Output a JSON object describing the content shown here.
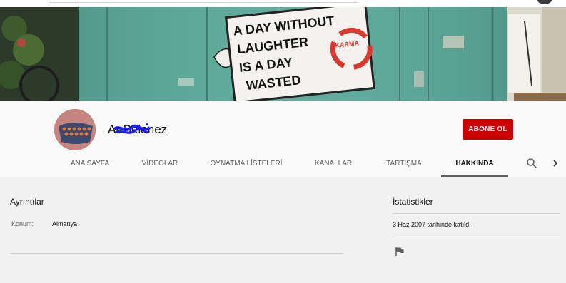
{
  "channel": {
    "name": "Ar Belanez",
    "subscribe_label": "ABONE OL"
  },
  "tabs": [
    {
      "label": "ANA SAYFA"
    },
    {
      "label": "VİDEOLAR"
    },
    {
      "label": "OYNATMA LİSTELERİ"
    },
    {
      "label": "KANALLAR"
    },
    {
      "label": "TARTIŞMA"
    },
    {
      "label": "HAKKINDA"
    }
  ],
  "active_tab": "HAKKINDA",
  "icons": {
    "tab_search": "search-icon",
    "tab_next": "chevron-right-icon",
    "report": "flag-icon"
  },
  "details": {
    "title": "Ayrıntılar",
    "location_label": "Konum:",
    "location_value": "Almanya"
  },
  "stats": {
    "title": "İstatistikler",
    "joined": "3 Haz 2007 tarihinde katıldı"
  },
  "banner": {
    "sign_text": [
      "A DAY WITHOUT",
      "LAUGHTER",
      "IS A DAY",
      "WASTED"
    ],
    "sticker_text": "KARMA"
  },
  "colors": {
    "subscribe": "#cc0000",
    "banner_wall": "#5fa99a",
    "scribble": "#1a1aff"
  }
}
